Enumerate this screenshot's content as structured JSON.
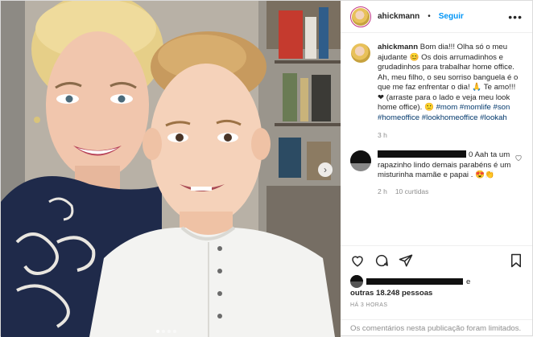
{
  "header": {
    "username": "ahickmann",
    "separator": "•",
    "follow_label": "Seguir",
    "more_icon": "more-horizontal-icon"
  },
  "caption": {
    "username": "ahickmann",
    "line1": " Bom dia!!! Olha só o meu ajudante ",
    "line2": " Os dois arrumadinhos e grudadinhos para trabalhar home office. Ah, meu filho, o seu sorriso banguela é o que me faz enfrentar o dia! ",
    "line3": " Te amo!!! ",
    "line4": " (arraste para o lado e veja meu look home office). ",
    "hashtags": [
      "#mom",
      "#momlife",
      "#son",
      "#homeoffice",
      "#lookhomeoffice",
      "#lookah"
    ],
    "time": "3 h"
  },
  "comment": {
    "text": "0 Aah ta um rapazinho lindo demais parabéns é um misturinha mamãe e papai . ",
    "time": "2 h",
    "likes": "10 curtidas"
  },
  "likes": {
    "connector": "e",
    "others": "outras 18.248 pessoas",
    "timeago": "HÁ 3 HORAS"
  },
  "footer": {
    "text": "Os comentários nesta publicação foram limitados."
  },
  "carousel": {
    "next_icon": "chevron-right-icon",
    "dots": 4,
    "active_dot": 0
  },
  "colors": {
    "follow": "#0095f6",
    "hashtag": "#00376b",
    "meta": "#8e8e8e",
    "border": "#dbdbdb"
  }
}
